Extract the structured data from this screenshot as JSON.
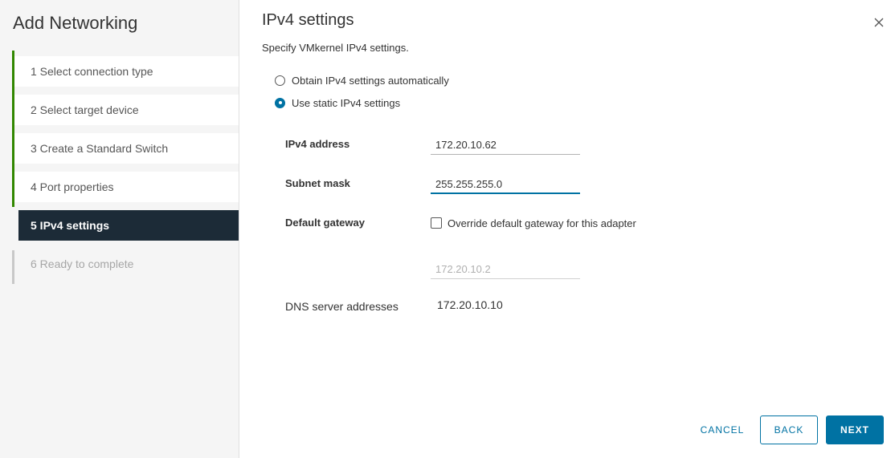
{
  "wizard": {
    "title": "Add Networking",
    "steps": [
      {
        "label": "1  Select connection type",
        "state": "done"
      },
      {
        "label": "2  Select target device",
        "state": "done"
      },
      {
        "label": "3  Create a Standard Switch",
        "state": "done"
      },
      {
        "label": "4  Port properties",
        "state": "done"
      },
      {
        "label": "5  IPv4 settings",
        "state": "active"
      },
      {
        "label": "6  Ready to complete",
        "state": "pending"
      }
    ]
  },
  "main": {
    "title": "IPv4 settings",
    "subtitle": "Specify VMkernel IPv4 settings.",
    "close_icon": "close-icon",
    "radios": {
      "auto_label": "Obtain IPv4 settings automatically",
      "static_label": "Use static IPv4 settings",
      "selected": "static"
    },
    "fields": {
      "ipv4_address_label": "IPv4 address",
      "ipv4_address_value": "172.20.10.62",
      "subnet_mask_label": "Subnet mask",
      "subnet_mask_value": "255.255.255.0",
      "default_gateway_label": "Default gateway",
      "override_gateway_label": "Override default gateway for this adapter",
      "override_gateway_checked": false,
      "gateway_value": "172.20.10.2",
      "dns_label": "DNS server addresses",
      "dns_value": "172.20.10.10"
    }
  },
  "footer": {
    "cancel_label": "CANCEL",
    "back_label": "BACK",
    "next_label": "NEXT"
  },
  "colors": {
    "accent": "#0072a3",
    "completed_step": "#318700",
    "active_step_bg": "#1c2b37",
    "sidebar_bg": "#f5f5f5"
  }
}
